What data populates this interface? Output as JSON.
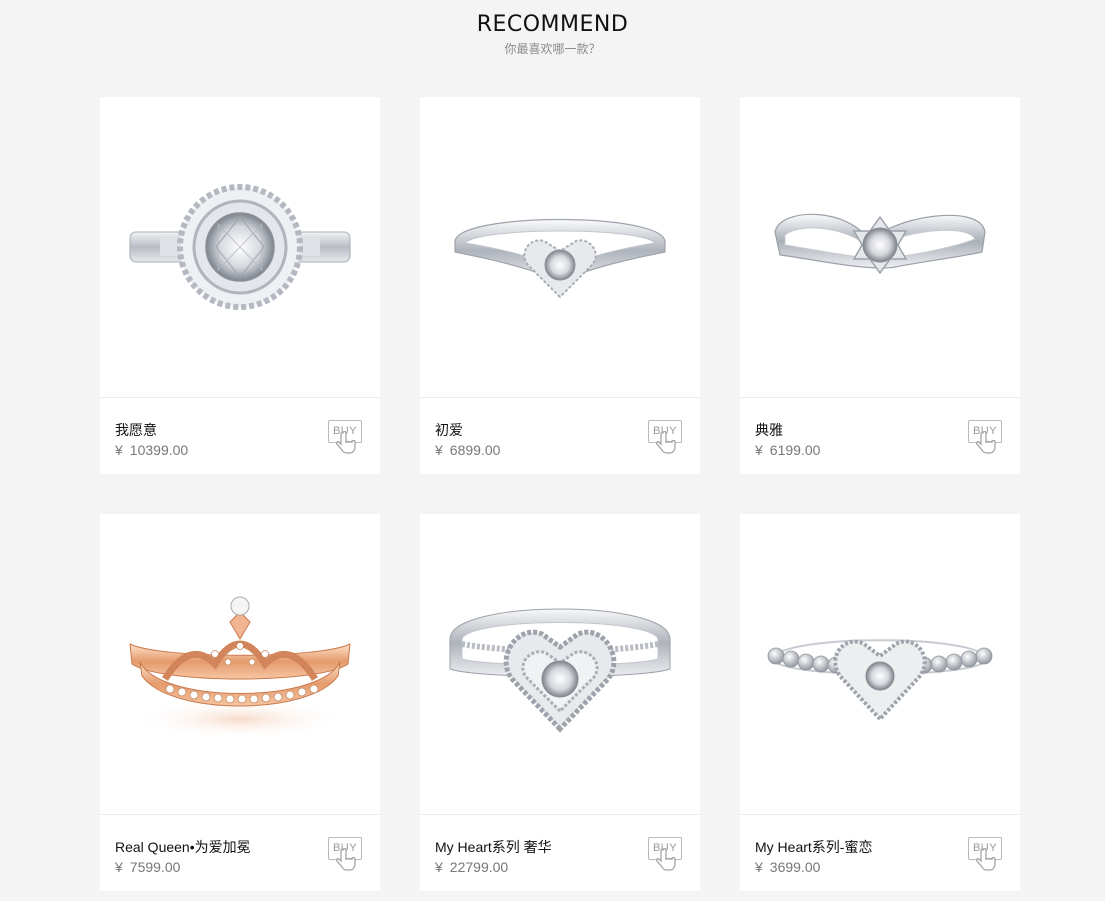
{
  "header": {
    "title": "RECOMMEND",
    "subtitle": "你最喜欢哪一款？"
  },
  "products": [
    {
      "name": "我愿意",
      "currency": "¥",
      "price": "10399.00",
      "buy_label": "BUY",
      "style": "halo-round"
    },
    {
      "name": "初爱",
      "currency": "¥",
      "price": "6899.00",
      "buy_label": "BUY",
      "style": "heart-solitaire"
    },
    {
      "name": "典雅",
      "currency": "¥",
      "price": "6199.00",
      "buy_label": "BUY",
      "style": "twist-solitaire"
    },
    {
      "name": "Real Queen•为爱加冕",
      "currency": "¥",
      "price": "7599.00",
      "buy_label": "BUY",
      "style": "rose-crown"
    },
    {
      "name": "My Heart系列 奢华",
      "currency": "¥",
      "price": "22799.00",
      "buy_label": "BUY",
      "style": "heart-halo-split"
    },
    {
      "name": "My Heart系列-蜜恋",
      "currency": "¥",
      "price": "3699.00",
      "buy_label": "BUY",
      "style": "heart-bead"
    }
  ],
  "colors": {
    "background": "#f4f4f4",
    "card": "#ffffff",
    "silver": "#c9ccd2",
    "rose_gold": "#e8a17a"
  }
}
